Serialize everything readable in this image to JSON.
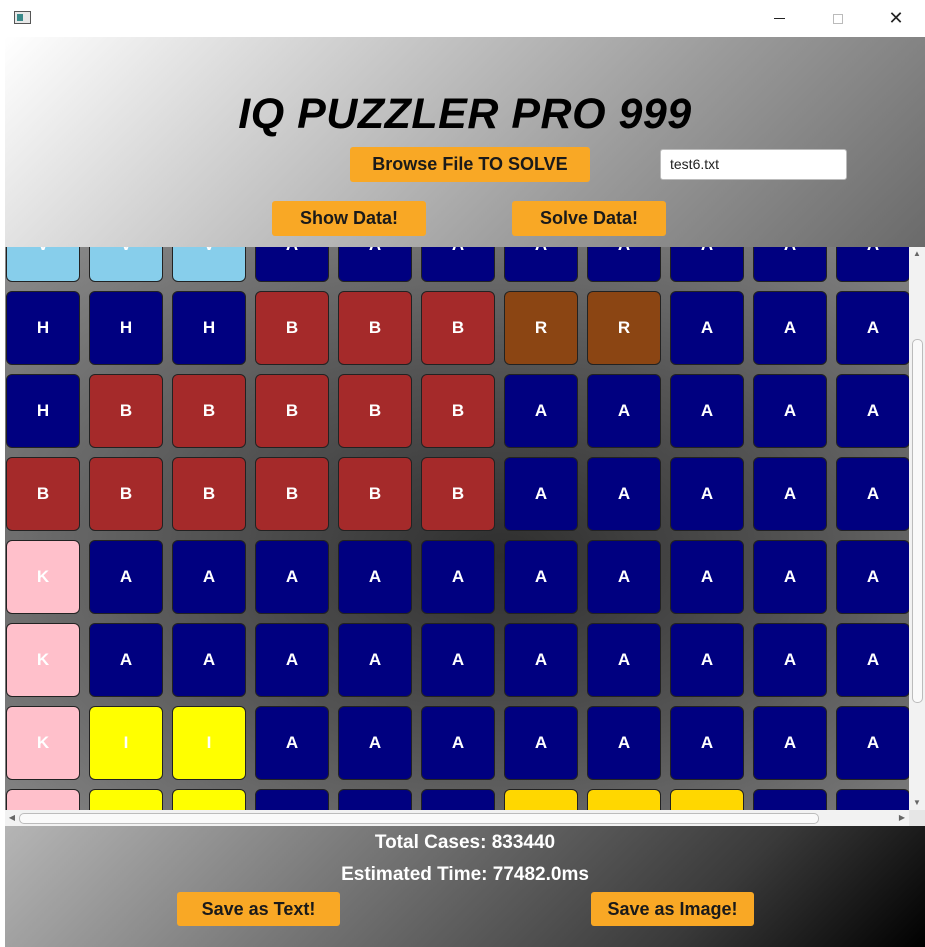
{
  "window": {
    "icons": {
      "app": "app-icon",
      "minimize": "minimize-icon",
      "maximize": "maximize-icon",
      "close": "close-icon"
    },
    "close_glyph": "✕"
  },
  "header": {
    "title": "IQ PUZZLER PRO 999",
    "browse_label": "Browse File TO SOLVE",
    "file_value": "test6.txt",
    "show_label": "Show Data!",
    "solve_label": "Solve Data!"
  },
  "colors": {
    "accent_button": "#f9a825",
    "pieces": {
      "A": "#000080",
      "H": "#000080",
      "B": "#a52a2a",
      "R": "#8b4513",
      "V": "#87ceeb",
      "K": "#ffc0cb",
      "I": "#ffff00",
      "G": "#ffd700"
    }
  },
  "board": {
    "rows": [
      [
        "V",
        "V",
        "V",
        "A",
        "A",
        "A",
        "A",
        "A",
        "A",
        "A",
        "A"
      ],
      [
        "H",
        "H",
        "H",
        "B",
        "B",
        "B",
        "R",
        "R",
        "A",
        "A",
        "A"
      ],
      [
        "H",
        "B",
        "B",
        "B",
        "B",
        "B",
        "A",
        "A",
        "A",
        "A",
        "A"
      ],
      [
        "B",
        "B",
        "B",
        "B",
        "B",
        "B",
        "A",
        "A",
        "A",
        "A",
        "A"
      ],
      [
        "K",
        "A",
        "A",
        "A",
        "A",
        "A",
        "A",
        "A",
        "A",
        "A",
        "A"
      ],
      [
        "K",
        "A",
        "A",
        "A",
        "A",
        "A",
        "A",
        "A",
        "A",
        "A",
        "A"
      ],
      [
        "K",
        "I",
        "I",
        "A",
        "A",
        "A",
        "A",
        "A",
        "A",
        "A",
        "A"
      ],
      [
        "K",
        "I",
        "I",
        "A",
        "A",
        "A",
        "G",
        "G",
        "G",
        "A",
        "A"
      ]
    ]
  },
  "footer": {
    "total_cases": "Total Cases: 833440",
    "estimated_time": "Estimated Time: 77482.0ms",
    "save_text_label": "Save as Text!",
    "save_image_label": "Save as Image!"
  }
}
